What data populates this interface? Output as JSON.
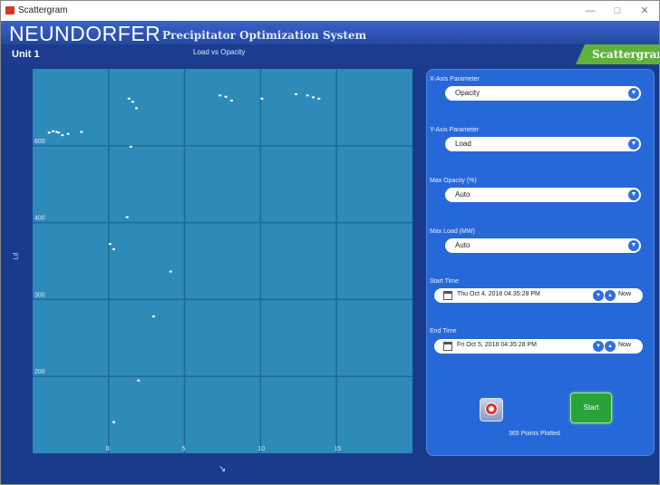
{
  "window": {
    "title": "Scattergram"
  },
  "header": {
    "brand": "NEUNDORFER",
    "subtitle": "Precipitator Optimization System",
    "unit": "Unit 1",
    "chart_title": "Load vs Opacity",
    "active_tab": "Scattergram"
  },
  "controls": {
    "x_axis": {
      "label": "X-Axis Parameter",
      "value": "Opacity"
    },
    "y_axis": {
      "label": "Y-Axis Parameter",
      "value": "Load"
    },
    "max_opacity": {
      "label": "Max Opacity (%)",
      "value": "Auto"
    },
    "max_load": {
      "label": "Max Load (MW)",
      "value": "Auto"
    },
    "start_time": {
      "label": "Start Time",
      "value": "Thu Oct  4, 2018 04:35:28 PM",
      "now_label": "Now"
    },
    "end_time": {
      "label": "End Time",
      "value": "Fri Oct  5, 2018 04:35:28 PM",
      "now_label": "Now"
    },
    "start_button": "Start",
    "points_plotted": "365 Points Plotted"
  },
  "colors": {
    "plot_bg": "#2e8ab9",
    "panel_bg": "#2768d8",
    "window_bg": "#1a3b8c",
    "accent": "#5fb13c"
  },
  "chart_data": {
    "type": "scatter",
    "xlabel": "",
    "ylabel": "Ld",
    "y_ticks": [
      "200",
      "300",
      "400",
      "600"
    ],
    "x_ticks": [
      "0",
      "5",
      "10",
      "15"
    ],
    "grid": true,
    "points": [
      [
        0.8,
        602
      ],
      [
        1.0,
        604
      ],
      [
        1.2,
        603
      ],
      [
        1.5,
        598
      ],
      [
        1.8,
        600
      ],
      [
        2.5,
        603
      ],
      [
        1.3,
        602
      ],
      [
        5.0,
        655
      ],
      [
        5.2,
        650
      ],
      [
        5.4,
        640
      ],
      [
        5.1,
        580
      ],
      [
        4.9,
        470
      ],
      [
        4.2,
        420
      ],
      [
        4.0,
        428
      ],
      [
        7.2,
        385
      ],
      [
        6.3,
        315
      ],
      [
        5.5,
        215
      ],
      [
        4.2,
        150
      ],
      [
        9.8,
        660
      ],
      [
        10.1,
        658
      ],
      [
        10.4,
        652
      ],
      [
        12.0,
        655
      ],
      [
        14.4,
        660
      ],
      [
        15.0,
        655
      ],
      [
        13.8,
        662
      ],
      [
        14.7,
        657
      ]
    ]
  }
}
